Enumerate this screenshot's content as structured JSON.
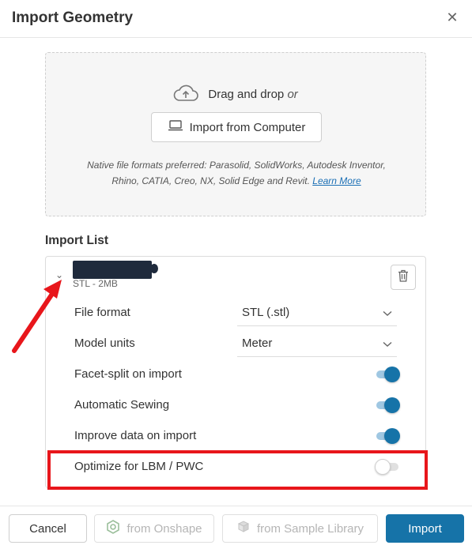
{
  "dialog": {
    "title": "Import Geometry",
    "close_glyph": "✕"
  },
  "dropzone": {
    "drag_text": "Drag and drop",
    "or_text": "or",
    "import_button_label": "Import from Computer",
    "native_note": "Native file formats preferred: Parasolid, SolidWorks, Autodesk Inventor, Rhino, CATIA, Creo, NX, Solid Edge and Revit.",
    "learn_more": "Learn More"
  },
  "import_list": {
    "heading": "Import List",
    "file": {
      "meta": "STL - 2MB",
      "chevron_glyph": "⌄"
    },
    "settings": [
      {
        "label": "File format",
        "type": "select",
        "value": "STL (.stl)"
      },
      {
        "label": "Model units",
        "type": "select",
        "value": "Meter"
      },
      {
        "label": "Facet-split on import",
        "type": "toggle",
        "on": true
      },
      {
        "label": "Automatic Sewing",
        "type": "toggle",
        "on": true
      },
      {
        "label": "Improve data on import",
        "type": "toggle",
        "on": true
      },
      {
        "label": "Optimize for LBM / PWC",
        "type": "toggle",
        "on": false
      }
    ]
  },
  "footer": {
    "cancel": "Cancel",
    "onshape": "from Onshape",
    "sample_library": "from Sample Library",
    "import": "Import"
  },
  "colors": {
    "accent": "#1673a8",
    "annotation_red": "#e8161b"
  }
}
